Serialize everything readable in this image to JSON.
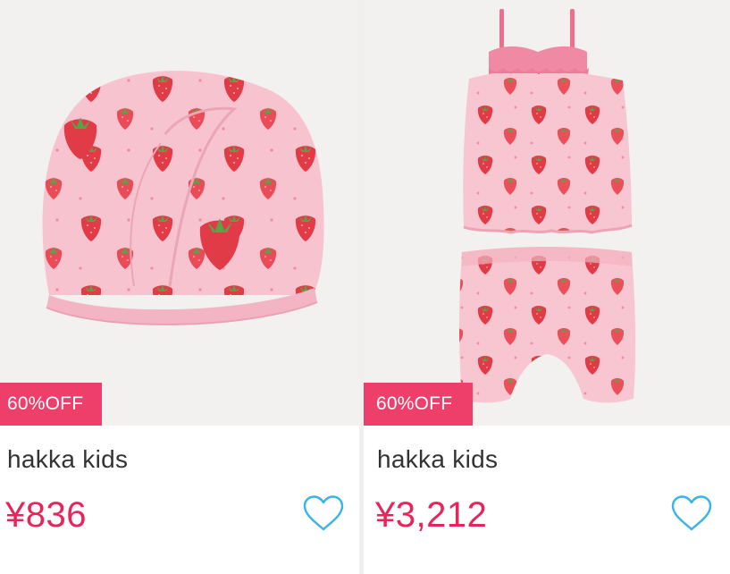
{
  "products": [
    {
      "badge": "60%OFF",
      "brand": "hakka kids",
      "price": "¥836",
      "image_subject": "strawberry-print swim cap",
      "favorite": false
    },
    {
      "badge": "60%OFF",
      "brand": "hakka kids",
      "price": "¥3,212",
      "image_subject": "strawberry-print tankini swimsuit set",
      "favorite": false
    }
  ],
  "colors": {
    "badge_bg": "#ee3e6a",
    "price": "#e8245a",
    "heart": "#3ab4e8",
    "fabric": "#f6c3cf",
    "strawberry": "#e23b48"
  },
  "icons": {
    "favorite": "heart-outline-icon"
  }
}
